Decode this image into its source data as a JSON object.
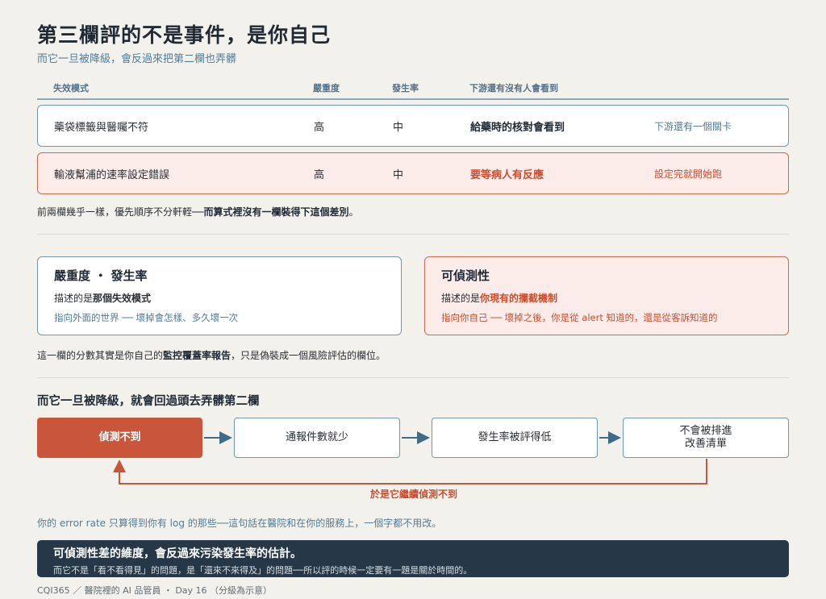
{
  "header": {
    "title": "第三欄評的不是事件，是你自己",
    "subtitle": "而它一旦被降級，會反過來把第二欄也弄髒"
  },
  "table": {
    "columns": [
      "失效模式",
      "嚴重度",
      "發生率",
      "下游還有沒有人會看到"
    ],
    "rows": [
      {
        "mode": "藥袋標籤與醫囑不符",
        "severity": "高",
        "occurrence": "中",
        "downstream": "給藥時的核對會看到",
        "note": "下游還有一個關卡"
      },
      {
        "mode": "輸液幫浦的速率設定錯誤",
        "severity": "高",
        "occurrence": "中",
        "downstream": "要等病人有反應",
        "note": "設定完就開始跑"
      }
    ],
    "footnote_prefix": "前兩欄幾乎一樣，優先順序不分軒輊──",
    "footnote_bold": "而算式裡沒有一欄裝得下這個差別",
    "footnote_suffix": "。"
  },
  "cards": {
    "left": {
      "heading": "嚴重度 ・ 發生率",
      "desc_prefix": "描述的是",
      "desc_bold": "那個失效模式",
      "sub": "指向外面的世界 ── 壞掉會怎樣、多久壞一次"
    },
    "right": {
      "heading": "可偵測性",
      "desc_prefix": "描述的是",
      "desc_bold": "你現有的攔截機制",
      "sub": "指向你自己 ── 壞掉之後，你是從 alert 知道的，還是從客訴知道的"
    },
    "footnote_prefix": "這一欄的分數其實是你自己的",
    "footnote_bold": "監控覆蓋率報告",
    "footnote_suffix": "，只是偽裝成一個風險評估的欄位。"
  },
  "flow": {
    "title": "而它一旦被降級，就會回過頭去弄髒第二欄",
    "steps": [
      "偵測不到",
      "通報件數就少",
      "發生率被評得低",
      "不會被排進\n改善清單"
    ],
    "loop_label": "於是它繼續偵測不到",
    "note": "你的 error rate 只算得到你有 log 的那些──這句話在醫院和在你的服務上，一個字都不用改。"
  },
  "banner": {
    "heading": "可偵測性差的維度，會反過來污染發生率的估計。",
    "sub": "而它不是「看不看得見」的問題，是「還來不來得及」的問題──所以評的時候一定要有一題是關於時間的。"
  },
  "footer": "CQI365 ／ 醫院裡的 AI 品管員 ・ Day 16 （分級為示意）"
}
